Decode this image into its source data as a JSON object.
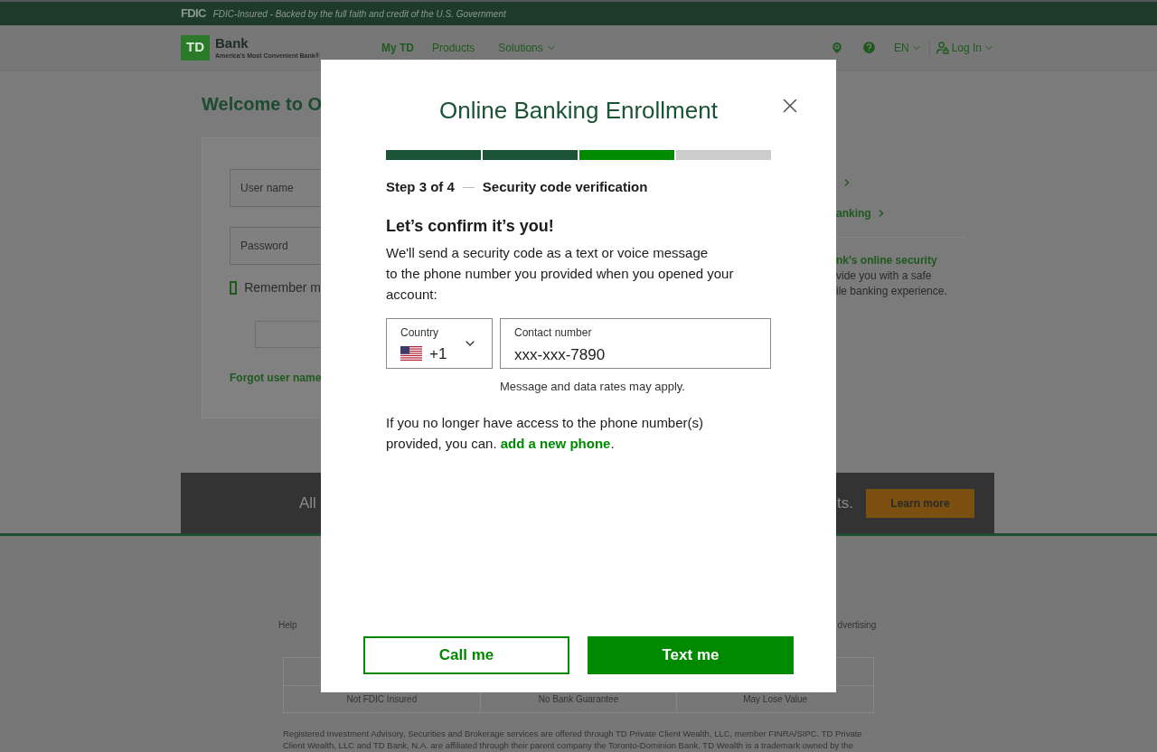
{
  "fdic_bar": {
    "logo": "FDIC",
    "tagline": "FDIC-Insured - Backed by the full faith and credit of the U.S. Government"
  },
  "header": {
    "logo": {
      "mark": "TD",
      "name": "Bank",
      "slogan": "America's Most Convenient Bank®"
    },
    "nav": [
      {
        "label": "My TD",
        "selected": true,
        "dropdown": false
      },
      {
        "label": "Products",
        "selected": false,
        "dropdown": false
      },
      {
        "label": "Solutions",
        "selected": false,
        "dropdown": true
      }
    ],
    "language": "EN",
    "login": "Log In"
  },
  "login_panel": {
    "title": "Welcome to O",
    "fields": [
      {
        "placeholder": "User name"
      },
      {
        "placeholder": "Password"
      }
    ],
    "remember": {
      "label": "Remember m",
      "checked": false
    },
    "forgot_link": "Forgot user name"
  },
  "side_links": [
    "anking"
  ],
  "security_note": {
    "title": "nk's online security",
    "lines": [
      "vide you with a safe",
      "ile banking experience."
    ]
  },
  "banner": {
    "text_start": "All",
    "text_end": "ts.",
    "button": "Learn more"
  },
  "footer": {
    "links": [
      "Help",
      "dvertising"
    ],
    "table_rows": [
      [
        "Not FDIC Insured",
        "No Bank Guarantee",
        "May Lose Value"
      ]
    ],
    "disclaimer": [
      "Registered Investment Advisory, Securities and Brokerage services are offered through TD Private Client Wealth, LLC, member FINRA/SIPC. TD Private",
      "Client Wealth, LLC and TD Bank, N.A. are affiliated through their parent company the Toronto-Dominion Bank. TD Wealth is a trademark owned by the"
    ]
  },
  "modal": {
    "title": "Online Banking Enrollment",
    "steps": [
      {
        "kind": "done"
      },
      {
        "kind": "done"
      },
      {
        "kind": "current"
      },
      {
        "kind": "todo"
      }
    ],
    "step_label": "Step 3 of 4",
    "step_name": "Security code verification",
    "heading": "Let’s confirm it’s you!",
    "message": "We'll send a security code as a text or voice message\nto the phone number you provided when you opened your account:",
    "country": {
      "label": "Country",
      "value": "+1"
    },
    "contact": {
      "label": "Contact number",
      "value": "xxx-xxx-7890"
    },
    "rates_note": "Message and data rates may apply.",
    "help_text": "If you no longer have access to the phone number(s) provided, you can. ",
    "help_link": "add a new phone",
    "help_end": ".",
    "buttons": [
      {
        "label": "Call me",
        "kind": "secondary"
      },
      {
        "label": "Text me",
        "kind": "primary"
      }
    ]
  }
}
